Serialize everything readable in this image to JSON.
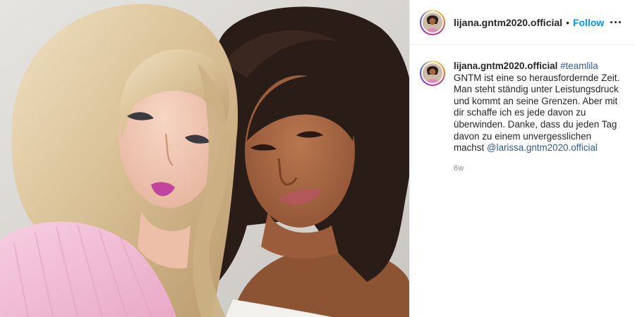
{
  "post": {
    "username": "lijana.gntm2020.official",
    "separator": "•",
    "follow_label": "Follow",
    "more_icon": "more-horizontal-icon",
    "caption": {
      "username": "lijana.gntm2020.official",
      "hashtag": "#teamlila",
      "text": "GNTM ist eine so herausfordernde Zeit. Man steht ständig unter Leistungsdruck und kommt an seine Grenzen. Aber mit dir schaffe ich es jede davon zu überwinden. Danke, dass du jeden Tag davon zu einem unvergesslichen machst",
      "mention": "@larissa.gntm2020.official"
    },
    "timestamp": "6w"
  },
  "colors": {
    "accent": "#0095f6",
    "link": "#2f5b9c",
    "muted": "#8e8e8e",
    "border": "#efefef"
  }
}
